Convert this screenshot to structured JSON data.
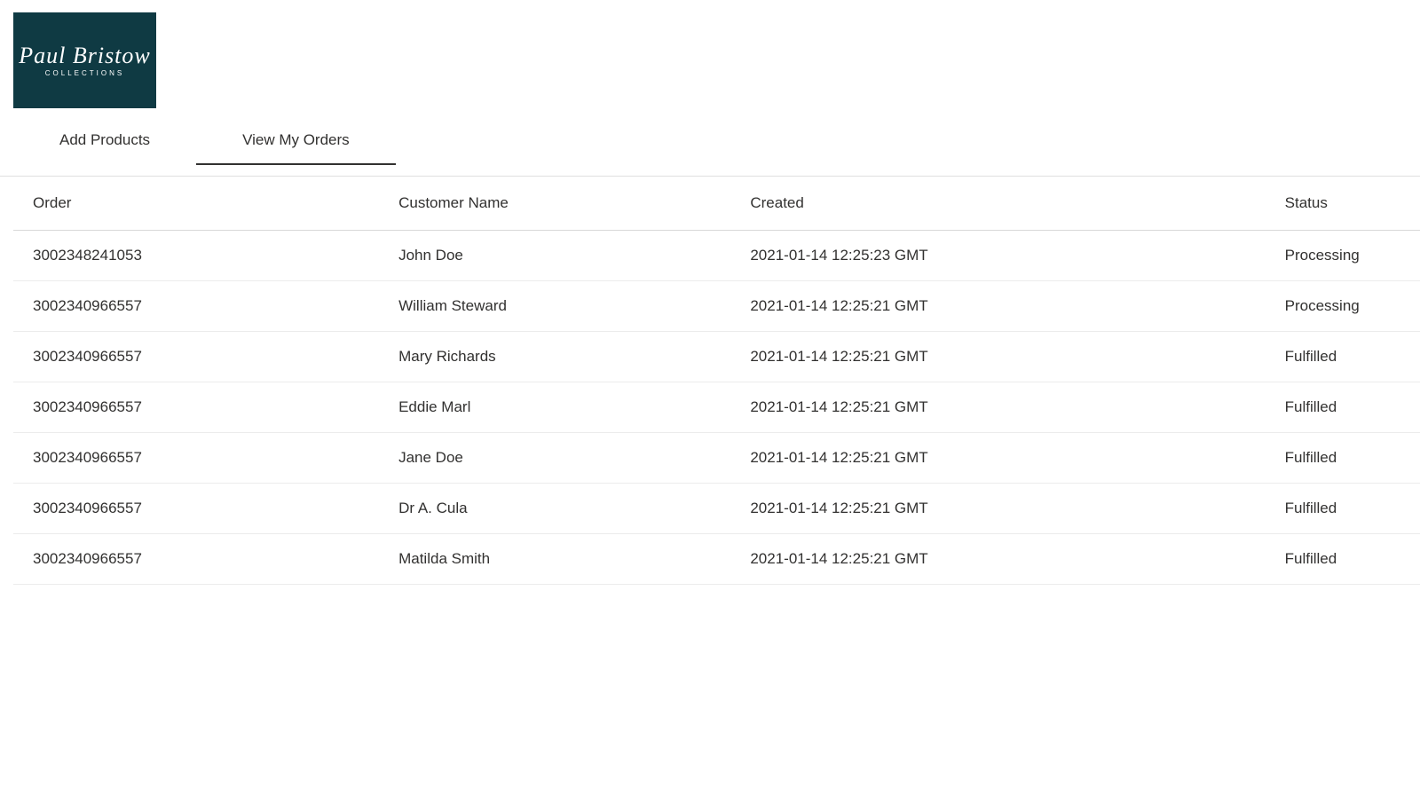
{
  "logo": {
    "brand": "Paul Bristow",
    "subtitle": "COLLECTIONS"
  },
  "tabs": {
    "add_products": "Add Products",
    "view_orders": "View My Orders"
  },
  "table": {
    "headers": {
      "order": "Order",
      "customer": "Customer Name",
      "created": "Created",
      "status": "Status"
    },
    "rows": [
      {
        "order": "3002348241053",
        "customer": "John Doe",
        "created": "2021-01-14 12:25:23 GMT",
        "status": "Processing"
      },
      {
        "order": "3002340966557",
        "customer": "William Steward",
        "created": "2021-01-14 12:25:21 GMT",
        "status": "Processing"
      },
      {
        "order": "3002340966557",
        "customer": "Mary Richards",
        "created": "2021-01-14 12:25:21 GMT",
        "status": "Fulfilled"
      },
      {
        "order": "3002340966557",
        "customer": "Eddie Marl",
        "created": "2021-01-14 12:25:21 GMT",
        "status": "Fulfilled"
      },
      {
        "order": "3002340966557",
        "customer": "Jane Doe",
        "created": "2021-01-14 12:25:21 GMT",
        "status": "Fulfilled"
      },
      {
        "order": "3002340966557",
        "customer": "Dr A. Cula",
        "created": "2021-01-14 12:25:21 GMT",
        "status": "Fulfilled"
      },
      {
        "order": "3002340966557",
        "customer": "Matilda Smith",
        "created": "2021-01-14 12:25:21 GMT",
        "status": "Fulfilled"
      }
    ]
  }
}
